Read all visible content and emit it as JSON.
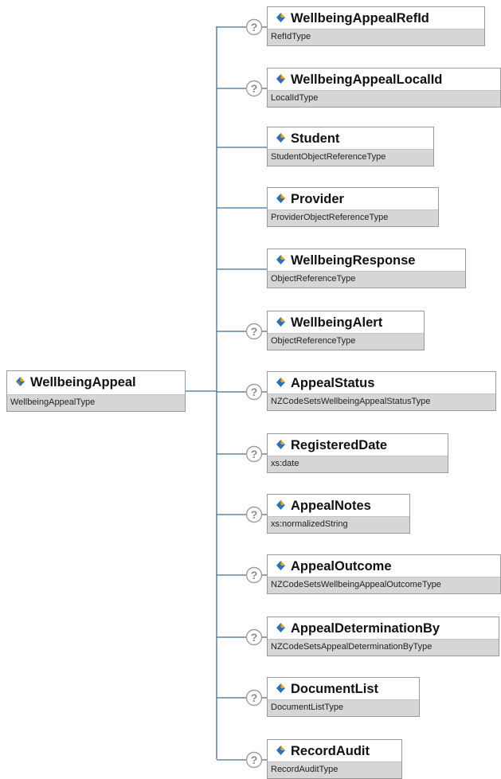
{
  "root": {
    "name": "WellbeingAppeal",
    "type": "WellbeingAppealType"
  },
  "children": [
    {
      "name": "WellbeingAppealRefId",
      "type": "RefIdType",
      "optional": true
    },
    {
      "name": "WellbeingAppealLocalId",
      "type": "LocalIdType",
      "optional": true
    },
    {
      "name": "Student",
      "type": "StudentObjectReferenceType",
      "optional": false
    },
    {
      "name": "Provider",
      "type": "ProviderObjectReferenceType",
      "optional": false
    },
    {
      "name": "WellbeingResponse",
      "type": "ObjectReferenceType",
      "optional": false
    },
    {
      "name": "WellbeingAlert",
      "type": "ObjectReferenceType",
      "optional": true
    },
    {
      "name": "AppealStatus",
      "type": "NZCodeSetsWellbeingAppealStatusType",
      "optional": true
    },
    {
      "name": "RegisteredDate",
      "type": "xs:date",
      "optional": true
    },
    {
      "name": "AppealNotes",
      "type": "xs:normalizedString",
      "optional": true
    },
    {
      "name": "AppealOutcome",
      "type": "NZCodeSetsWellbeingAppealOutcomeType",
      "optional": true
    },
    {
      "name": "AppealDeterminationBy",
      "type": "NZCodeSetsAppealDeterminationByType",
      "optional": true
    },
    {
      "name": "DocumentList",
      "type": "DocumentListType",
      "optional": true
    },
    {
      "name": "RecordAudit",
      "type": "RecordAuditType",
      "optional": true
    }
  ],
  "colors": {
    "connector": "#3f6f98",
    "optional_badge": "#9e9e9e",
    "type_bar": "#d6d6d6",
    "icon_blue": "#2f6fb4",
    "icon_gold": "#e3a41d"
  }
}
